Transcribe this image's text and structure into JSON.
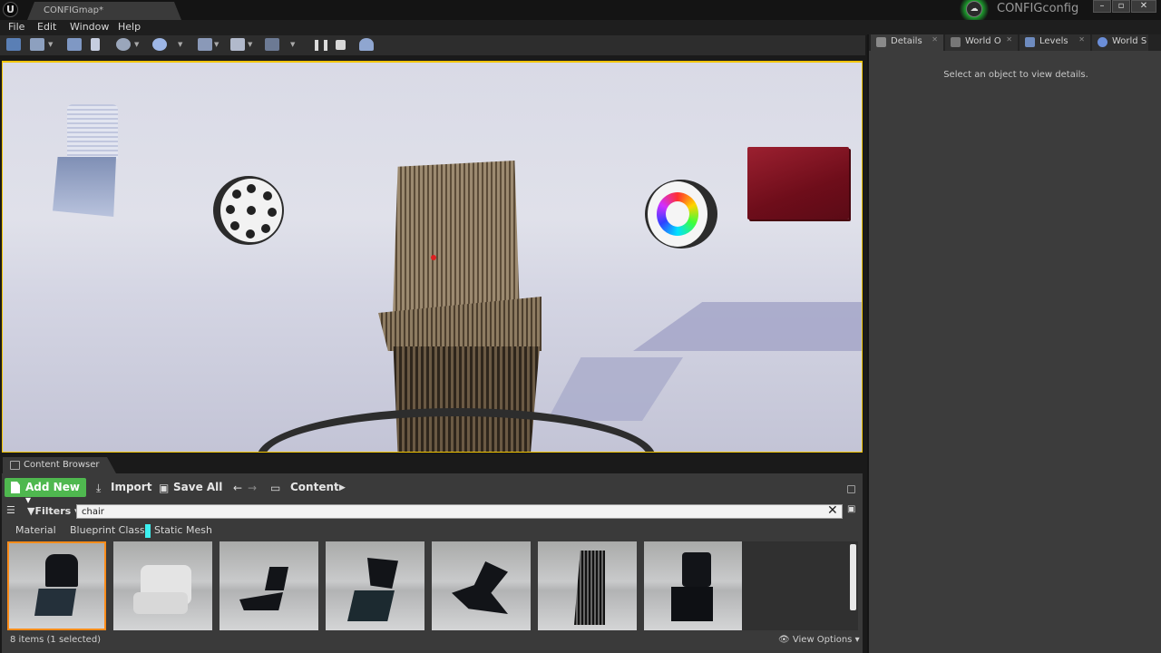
{
  "window": {
    "doc_tab": "CONFIGmap*",
    "project_name": "CONFIGconfig",
    "controls": [
      "–",
      "▫",
      "✕"
    ]
  },
  "menu": [
    "File",
    "Edit",
    "Window",
    "Help"
  ],
  "toolbar": {
    "icons": [
      "save-icon",
      "source-control-icon",
      "content-icon",
      "marketplace-icon",
      "settings-icon",
      "blueprints-icon",
      "cinematics-icon",
      "build-icon",
      "play-icon",
      "pause-icon",
      "stop-icon",
      "eject-icon"
    ]
  },
  "details_panel": {
    "tabs": [
      "Details",
      "World O",
      "Levels",
      "World S"
    ],
    "empty_message": "Select an object to view details."
  },
  "content_browser": {
    "tab_label": "Content Browser",
    "add_new": "Add New",
    "import": "Import",
    "save_all": "Save All",
    "path": "Content",
    "filters_label": "Filters",
    "search_value": "chair",
    "filter_chips": [
      "Material",
      "Blueprint Class",
      "Static Mesh"
    ],
    "active_chip": "Static Mesh",
    "status": "8 items (1 selected)",
    "view_options": "View Options",
    "thumbnail_count_visible": 7
  },
  "colors": {
    "accent_green": "#4fb84f",
    "viewport_border": "#f1c400",
    "static_mesh_chip": "#3cf0f0"
  }
}
